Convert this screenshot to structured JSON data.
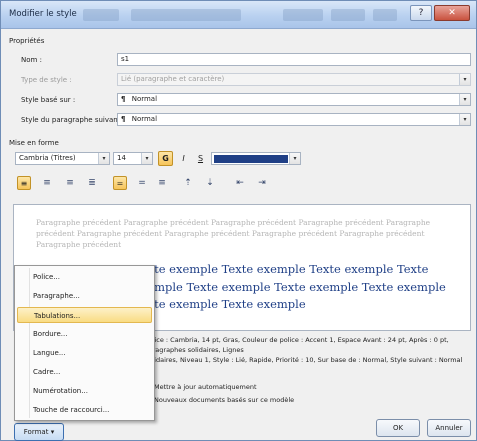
{
  "window": {
    "title": "Modifier le style",
    "controls": {
      "minimize": "–",
      "maximize": "□",
      "close": "✕"
    }
  },
  "properties": {
    "section_label": "Propriétés",
    "name_label": "Nom :",
    "name_value": "s1",
    "type_label": "Type de style :",
    "type_value": "Lié (paragraphe et caractère)",
    "based_on_label": "Style basé sur :",
    "based_on_value": "Normal",
    "next_label": "Style du paragraphe suivant :",
    "next_value": "Normal"
  },
  "formatting": {
    "section_label": "Mise en forme",
    "font": "Cambria (Titres)",
    "size": "14",
    "bold": "G",
    "italic": "I",
    "underline": "S",
    "color_value": "#1f3f86"
  },
  "paragraph_toolbar": {
    "icons": [
      "align-left-icon",
      "align-center-icon",
      "align-right-icon",
      "justify-icon",
      "line-spacing-single-icon",
      "line-spacing-15-icon",
      "line-spacing-double-icon",
      "space-before-icon",
      "space-after-icon",
      "decrease-indent-icon",
      "increase-indent-icon"
    ]
  },
  "preview": {
    "previous_text": "Paragraphe précédent Paragraphe précédent Paragraphe précédent Paragraphe précédent Paragraphe précédent Paragraphe précédent Paragraphe précédent Paragraphe précédent Paragraphe précédent Paragraphe précédent",
    "sample_text": "Texte exemple Texte exemple Texte exemple Texte exemple Texte exemple Texte exemple Texte exemple Texte exemple Texte exemple"
  },
  "description": {
    "line1": "Police : Cambria, 14 pt, Gras, Couleur de police : Accent 1, Espace Avant : 24 pt, Après : 0 pt, Paragraphes solidaires, Lignes",
    "line2": "solidaires, Niveau 1, Style : Lié, Rapide, Priorité : 10, Sur base de : Normal, Style suivant : Normal"
  },
  "options": {
    "add_quick": "Ajouter à la liste des styles rapides",
    "auto_update": "Mettre à jour automatiquement",
    "only_doc": "Uniquement dans ce document",
    "new_docs": "Nouveaux documents basés sur ce modèle"
  },
  "buttons": {
    "format": "Format",
    "format_arrow": "▾",
    "ok": "OK",
    "cancel": "Annuler"
  },
  "format_menu": {
    "items": [
      "Police...",
      "Paragraphe...",
      "Tabulations...",
      "Bordure...",
      "Langue...",
      "Cadre...",
      "Numérotation...",
      "Touche de raccourci..."
    ],
    "highlighted_index": 2
  }
}
